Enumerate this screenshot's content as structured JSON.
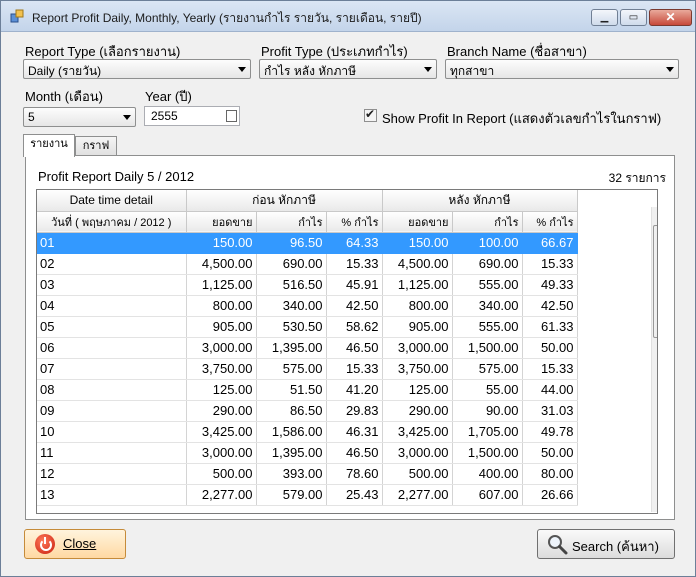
{
  "window": {
    "title": "Report Profit Daily, Monthly, Yearly (รายงานกำไร รายวัน, รายเดือน, รายปี)"
  },
  "filters": {
    "report_type_label": "Report Type (เลือกรายงาน)",
    "report_type_value": "Daily (รายวัน)",
    "profit_type_label": "Profit Type (ประเภทกำไร)",
    "profit_type_value": "กำไร หลัง หักภาษี",
    "branch_label": "Branch Name (ชื่อสาขา)",
    "branch_value": "ทุกสาขา",
    "month_label": "Month (เดือน)",
    "month_value": "5",
    "year_label": "Year (ปี)",
    "year_value": "2555",
    "show_profit_label": "Show Profit In Report (แสดงตัวเลขกำไรในกราฟ)",
    "show_profit_checked": true
  },
  "tabs": [
    {
      "label": "รายงาน"
    },
    {
      "label": "กราฟ"
    }
  ],
  "report": {
    "title": "Profit Report Daily 5 / 2012",
    "count": "32 รายการ"
  },
  "grid": {
    "group_date": "Date time detail",
    "group_before": "ก่อน หักภาษี",
    "group_after": "หลัง หักภาษี",
    "col_date": "วันที่ ( พฤษภาคม / 2012 )",
    "col_sales": "ยอดขาย",
    "col_profit": "กำไร",
    "col_pct": "% กำไร",
    "rows": [
      {
        "day": "01",
        "s1": "150.00",
        "p1": "96.50",
        "r1": "64.33",
        "s2": "150.00",
        "p2": "100.00",
        "r2": "66.67"
      },
      {
        "day": "02",
        "s1": "4,500.00",
        "p1": "690.00",
        "r1": "15.33",
        "s2": "4,500.00",
        "p2": "690.00",
        "r2": "15.33"
      },
      {
        "day": "03",
        "s1": "1,125.00",
        "p1": "516.50",
        "r1": "45.91",
        "s2": "1,125.00",
        "p2": "555.00",
        "r2": "49.33"
      },
      {
        "day": "04",
        "s1": "800.00",
        "p1": "340.00",
        "r1": "42.50",
        "s2": "800.00",
        "p2": "340.00",
        "r2": "42.50"
      },
      {
        "day": "05",
        "s1": "905.00",
        "p1": "530.50",
        "r1": "58.62",
        "s2": "905.00",
        "p2": "555.00",
        "r2": "61.33"
      },
      {
        "day": "06",
        "s1": "3,000.00",
        "p1": "1,395.00",
        "r1": "46.50",
        "s2": "3,000.00",
        "p2": "1,500.00",
        "r2": "50.00"
      },
      {
        "day": "07",
        "s1": "3,750.00",
        "p1": "575.00",
        "r1": "15.33",
        "s2": "3,750.00",
        "p2": "575.00",
        "r2": "15.33"
      },
      {
        "day": "08",
        "s1": "125.00",
        "p1": "51.50",
        "r1": "41.20",
        "s2": "125.00",
        "p2": "55.00",
        "r2": "44.00"
      },
      {
        "day": "09",
        "s1": "290.00",
        "p1": "86.50",
        "r1": "29.83",
        "s2": "290.00",
        "p2": "90.00",
        "r2": "31.03"
      },
      {
        "day": "10",
        "s1": "3,425.00",
        "p1": "1,586.00",
        "r1": "46.31",
        "s2": "3,425.00",
        "p2": "1,705.00",
        "r2": "49.78"
      },
      {
        "day": "11",
        "s1": "3,000.00",
        "p1": "1,395.00",
        "r1": "46.50",
        "s2": "3,000.00",
        "p2": "1,500.00",
        "r2": "50.00"
      },
      {
        "day": "12",
        "s1": "500.00",
        "p1": "393.00",
        "r1": "78.60",
        "s2": "500.00",
        "p2": "400.00",
        "r2": "80.00"
      },
      {
        "day": "13",
        "s1": "2,277.00",
        "p1": "579.00",
        "r1": "25.43",
        "s2": "2,277.00",
        "p2": "607.00",
        "r2": "26.66"
      }
    ]
  },
  "buttons": {
    "close": "Close",
    "search": "Search (ค้นหา)"
  },
  "colors": {
    "selection": "#3399ff",
    "close_button": "#ffd9a3"
  },
  "icons": {
    "app": "app-icon",
    "close": "power-icon",
    "search": "magnifier-icon"
  }
}
